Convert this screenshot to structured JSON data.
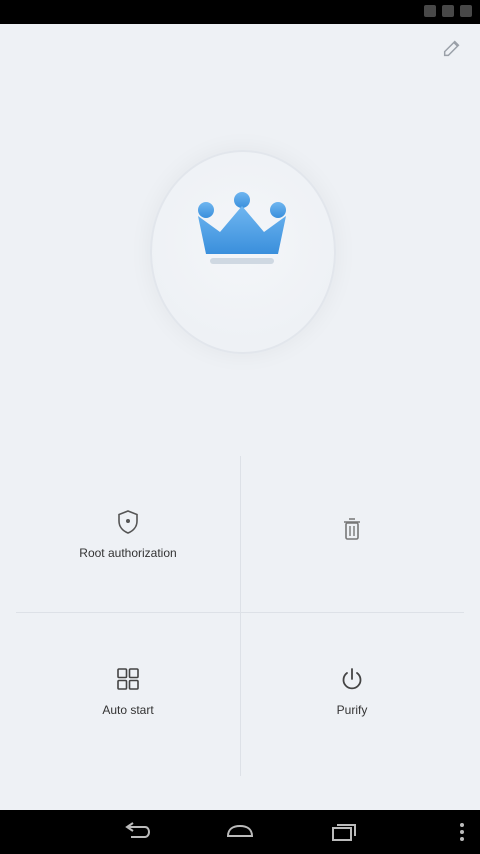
{
  "app_bar": {
    "title": "",
    "overflow_icon": "edit-icon"
  },
  "logo": {
    "icon": "crown-icon",
    "text": "",
    "color": "#4a9be6"
  },
  "tiles": [
    {
      "label": "Root authorization",
      "icon": "shield-icon"
    },
    {
      "label": "",
      "icon": "trash-icon"
    },
    {
      "label": "Auto start",
      "icon": "grid-icon"
    },
    {
      "label": "Purify",
      "icon": "power-icon"
    }
  ],
  "nav": {
    "back_icon": "back-icon",
    "home_icon": "home-icon",
    "recent_icon": "recent-apps-icon",
    "menu_icon": "menu-icon"
  }
}
